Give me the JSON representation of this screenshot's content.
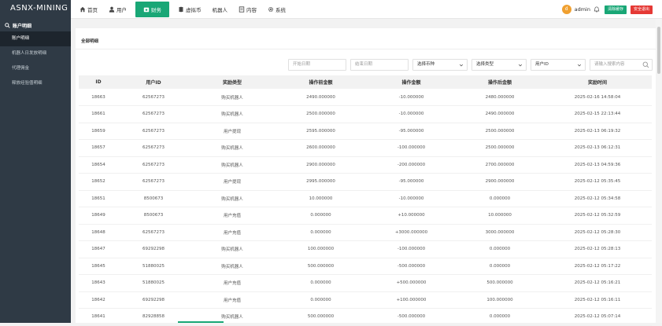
{
  "sidebar": {
    "brand": "ASNX-MINING",
    "group_label": "账户明细",
    "items": [
      {
        "label": "账户明细",
        "active": true
      },
      {
        "label": "机器人日发放明细",
        "active": false
      },
      {
        "label": "代理佣金",
        "active": false
      },
      {
        "label": "释放经验值明细",
        "active": false
      }
    ]
  },
  "topbar": {
    "nav": [
      {
        "label": "首页",
        "icon": "home-icon"
      },
      {
        "label": "用户",
        "icon": "user-icon"
      },
      {
        "label": "财务",
        "icon": "wallet-icon",
        "active": true
      },
      {
        "label": "虚拟币",
        "icon": "coins-icon"
      },
      {
        "label": "机器人",
        "icon": ""
      },
      {
        "label": "内容",
        "icon": "content-icon"
      },
      {
        "label": "系统",
        "icon": "gear-icon"
      }
    ],
    "avatar_letter": "d",
    "admin_name": "admin",
    "clear_cache_label": "清除缓存",
    "logout_label": "安全退出",
    "accent": "#19a776",
    "danger": "#e53935"
  },
  "panel": {
    "title": "全部明细",
    "filters": {
      "start_date_placeholder": "开始日期",
      "end_date_placeholder": "结束日期",
      "coin_select": "选择币种",
      "type_select": "选择类型",
      "user_id_select": "用户ID",
      "search_placeholder": "请输入搜索内容"
    },
    "columns": [
      "ID",
      "用户ID",
      "奖励类型",
      "操作前金额",
      "操作金额",
      "操作后金额",
      "奖励时间"
    ],
    "rows": [
      [
        "18663",
        "62567273",
        "购买机器人",
        "2490.000000",
        "-10.000000",
        "2480.000000",
        "2025-02-16 14:58:04"
      ],
      [
        "18661",
        "62567273",
        "购买机器人",
        "2500.000000",
        "-10.000000",
        "2490.000000",
        "2025-02-15 22:13:44"
      ],
      [
        "18659",
        "62567273",
        "用户提现",
        "2595.000000",
        "-95.000000",
        "2500.000000",
        "2025-02-13 06:19:32"
      ],
      [
        "18657",
        "62567273",
        "购买机器人",
        "2600.000000",
        "-100.000000",
        "2500.000000",
        "2025-02-13 06:12:31"
      ],
      [
        "18654",
        "62567273",
        "购买机器人",
        "2900.000000",
        "-200.000000",
        "2700.000000",
        "2025-02-13 04:59:36"
      ],
      [
        "18652",
        "62567273",
        "用户提现",
        "2995.000000",
        "-95.000000",
        "2900.000000",
        "2025-02-12 05:35:45"
      ],
      [
        "18651",
        "8500673",
        "购买机器人",
        "10.000000",
        "-10.000000",
        "0.000000",
        "2025-02-12 05:34:58"
      ],
      [
        "18649",
        "8500673",
        "用户充值",
        "0.000000",
        "+10.000000",
        "10.000000",
        "2025-02-12 05:32:59"
      ],
      [
        "18648",
        "62567273",
        "用户充值",
        "0.000000",
        "+3000.000000",
        "3000.000000",
        "2025-02-12 05:28:30"
      ],
      [
        "18647",
        "69292298",
        "购买机器人",
        "100.000000",
        "-100.000000",
        "0.000000",
        "2025-02-12 05:28:13"
      ],
      [
        "18645",
        "51880025",
        "购买机器人",
        "500.000000",
        "-500.000000",
        "0.000000",
        "2025-02-12 05:17:22"
      ],
      [
        "18643",
        "51880025",
        "用户充值",
        "0.000000",
        "+500.000000",
        "500.000000",
        "2025-02-12 05:16:21"
      ],
      [
        "18642",
        "69292298",
        "用户充值",
        "0.000000",
        "+100.000000",
        "100.000000",
        "2025-02-12 05:16:11"
      ],
      [
        "18641",
        "82928858",
        "购买机器人",
        "500.000000",
        "-500.000000",
        "0.000000",
        "2025-02-12 05:07:14"
      ]
    ]
  }
}
